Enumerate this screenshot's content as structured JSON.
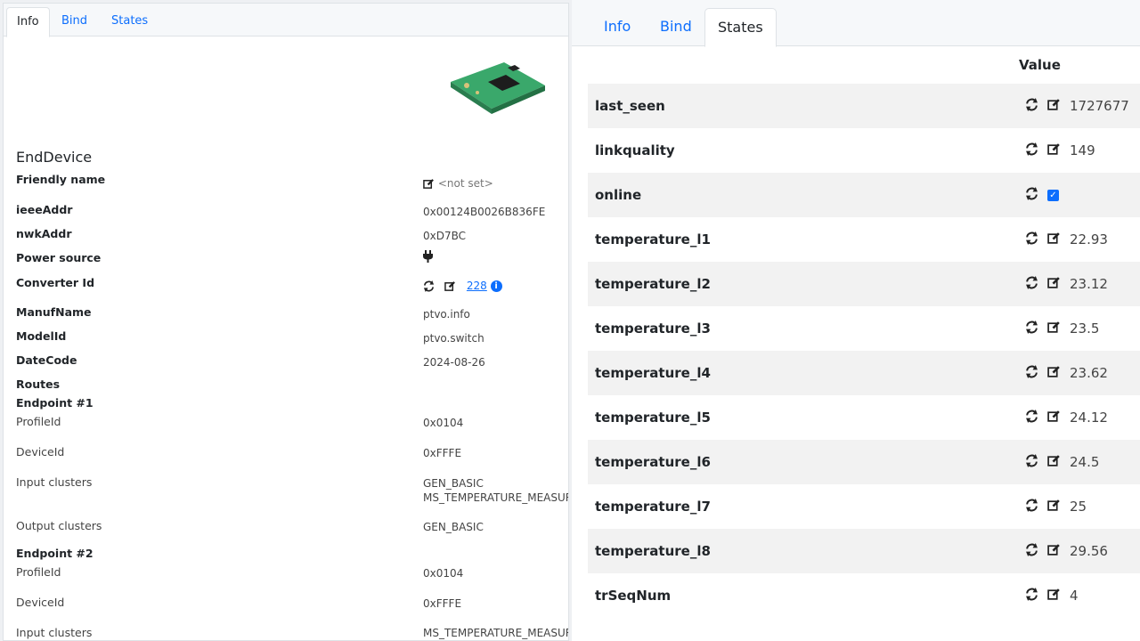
{
  "left_panel": {
    "tabs": [
      "Info",
      "Bind",
      "States"
    ],
    "active_tab": "Info",
    "device_type": "EndDevice",
    "fields": {
      "friendly_name": {
        "label": "Friendly name",
        "value": "<not set>"
      },
      "ieee_addr": {
        "label": "ieeeAddr",
        "value": "0x00124B0026B836FE"
      },
      "nwk_addr": {
        "label": "nwkAddr",
        "value": "0xD7BC"
      },
      "power_source": {
        "label": "Power source",
        "icon": "plug-icon"
      },
      "converter_id": {
        "label": "Converter Id",
        "value": "228"
      },
      "manuf_name": {
        "label": "ManufName",
        "value": "ptvo.info"
      },
      "model_id": {
        "label": "ModelId",
        "value": "ptvo.switch"
      },
      "date_code": {
        "label": "DateCode",
        "value": "2024-08-26"
      },
      "routes": {
        "label": "Routes"
      }
    },
    "endpoints": [
      {
        "title": "Endpoint #1",
        "profile_id_label": "ProfileId",
        "profile_id": "0x0104",
        "device_id_label": "DeviceId",
        "device_id": "0xFFFE",
        "input_clusters_label": "Input clusters",
        "input_clusters": [
          "GEN_BASIC",
          "MS_TEMPERATURE_MEASUREM"
        ],
        "output_clusters_label": "Output clusters",
        "output_clusters": [
          "GEN_BASIC"
        ]
      },
      {
        "title": "Endpoint #2",
        "profile_id_label": "ProfileId",
        "profile_id": "0x0104",
        "device_id_label": "DeviceId",
        "device_id": "0xFFFE",
        "input_clusters_label": "Input clusters",
        "input_clusters": [
          "MS_TEMPERATURE_MEASUREM"
        ]
      }
    ]
  },
  "right_panel": {
    "tabs": [
      "Info",
      "Bind",
      "States"
    ],
    "active_tab": "States",
    "column_header": "Value",
    "states": [
      {
        "name": "last_seen",
        "value": "1727677"
      },
      {
        "name": "linkquality",
        "value": "149"
      },
      {
        "name": "online",
        "value": "",
        "checked": true
      },
      {
        "name": "temperature_l1",
        "value": "22.93"
      },
      {
        "name": "temperature_l2",
        "value": "23.12"
      },
      {
        "name": "temperature_l3",
        "value": "23.5"
      },
      {
        "name": "temperature_l4",
        "value": "23.62"
      },
      {
        "name": "temperature_l5",
        "value": "24.12"
      },
      {
        "name": "temperature_l6",
        "value": "24.5"
      },
      {
        "name": "temperature_l7",
        "value": "25"
      },
      {
        "name": "temperature_l8",
        "value": "29.56"
      },
      {
        "name": "trSeqNum",
        "value": "4"
      }
    ]
  },
  "colors": {
    "accent": "#0d6efd",
    "stripe": "#f2f2f2",
    "device_pcb": "#3aa86b"
  }
}
